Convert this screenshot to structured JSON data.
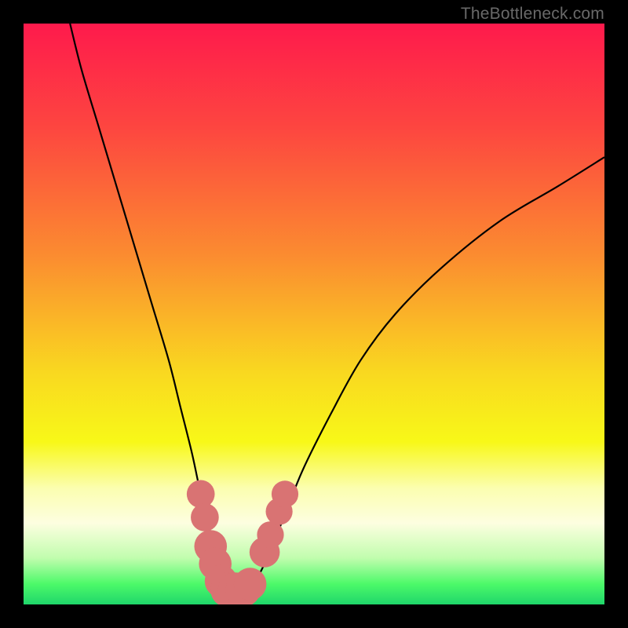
{
  "watermark": {
    "text": "TheBottleneck.com"
  },
  "colors": {
    "frame": "#000000",
    "curve": "#000000",
    "marker_fill": "#d97373",
    "marker_stroke": "#c05a5a",
    "gradient_stops": [
      {
        "offset": 0.0,
        "color": "#fe1a4c"
      },
      {
        "offset": 0.18,
        "color": "#fd4640"
      },
      {
        "offset": 0.4,
        "color": "#fb8c30"
      },
      {
        "offset": 0.6,
        "color": "#f9d820"
      },
      {
        "offset": 0.72,
        "color": "#f8f818"
      },
      {
        "offset": 0.8,
        "color": "#fbfeb0"
      },
      {
        "offset": 0.86,
        "color": "#fdfee0"
      },
      {
        "offset": 0.92,
        "color": "#c1fdae"
      },
      {
        "offset": 0.965,
        "color": "#4cf969"
      },
      {
        "offset": 1.0,
        "color": "#1fd66a"
      }
    ]
  },
  "chart_data": {
    "type": "line",
    "title": "",
    "xlabel": "",
    "ylabel": "",
    "xlim": [
      0,
      100
    ],
    "ylim": [
      0,
      100
    ],
    "series": [
      {
        "name": "bottleneck-curve",
        "x": [
          8,
          10,
          13,
          16,
          19,
          22,
          25,
          27,
          29,
          30.5,
          32,
          33,
          34,
          35,
          36,
          37.5,
          39,
          41,
          44,
          48,
          53,
          58,
          64,
          72,
          82,
          92,
          100
        ],
        "values": [
          100,
          92,
          82,
          72,
          62,
          52,
          42,
          34,
          26,
          19,
          13,
          9,
          5,
          3,
          2.5,
          2.5,
          3,
          6,
          13,
          23,
          33,
          42,
          50,
          58,
          66,
          72,
          77
        ]
      }
    ],
    "markers": [
      {
        "x": 30.5,
        "y": 19,
        "r": 1.6
      },
      {
        "x": 31.2,
        "y": 15,
        "r": 1.6
      },
      {
        "x": 32.2,
        "y": 10,
        "r": 2.0
      },
      {
        "x": 33.0,
        "y": 7,
        "r": 2.0
      },
      {
        "x": 34.0,
        "y": 4,
        "r": 2.0
      },
      {
        "x": 35.2,
        "y": 2.5,
        "r": 2.2
      },
      {
        "x": 36.5,
        "y": 2.5,
        "r": 2.2
      },
      {
        "x": 37.8,
        "y": 2.6,
        "r": 2.2
      },
      {
        "x": 39.0,
        "y": 3.5,
        "r": 2.0
      },
      {
        "x": 41.5,
        "y": 9,
        "r": 1.8
      },
      {
        "x": 42.5,
        "y": 12,
        "r": 1.5
      },
      {
        "x": 44.0,
        "y": 16,
        "r": 1.5
      },
      {
        "x": 45.0,
        "y": 19,
        "r": 1.5
      }
    ]
  }
}
